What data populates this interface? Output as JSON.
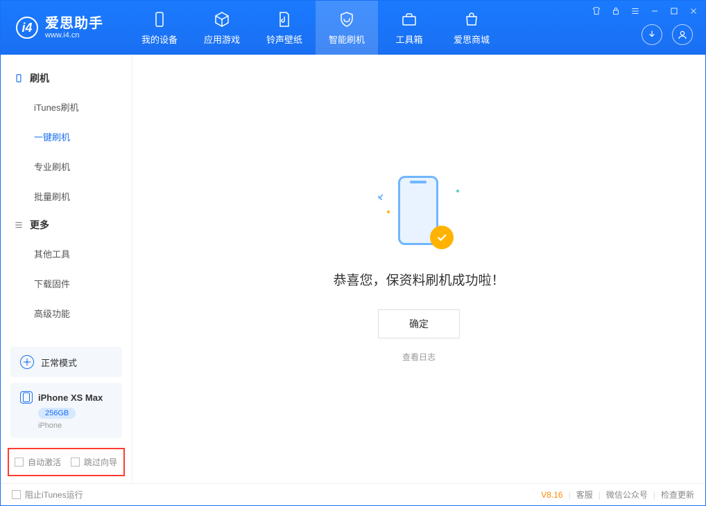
{
  "app": {
    "name": "爱思助手",
    "url": "www.i4.cn"
  },
  "nav": {
    "items": [
      {
        "label": "我的设备"
      },
      {
        "label": "应用游戏"
      },
      {
        "label": "铃声壁纸"
      },
      {
        "label": "智能刷机"
      },
      {
        "label": "工具箱"
      },
      {
        "label": "爱思商城"
      }
    ],
    "active_index": 3
  },
  "sidebar": {
    "group_flash": "刷机",
    "group_more": "更多",
    "flash_items": [
      {
        "label": "iTunes刷机"
      },
      {
        "label": "一键刷机"
      },
      {
        "label": "专业刷机"
      },
      {
        "label": "批量刷机"
      }
    ],
    "flash_active_index": 1,
    "more_items": [
      {
        "label": "其他工具"
      },
      {
        "label": "下载固件"
      },
      {
        "label": "高级功能"
      }
    ],
    "mode_label": "正常模式",
    "device": {
      "name": "iPhone XS Max",
      "capacity": "256GB",
      "type": "iPhone"
    },
    "opt_auto_activate": "自动激活",
    "opt_skip_guide": "跳过向导"
  },
  "main": {
    "success_text": "恭喜您，保资料刷机成功啦！",
    "ok_label": "确定",
    "log_link": "查看日志"
  },
  "footer": {
    "block_itunes": "阻止iTunes运行",
    "version": "V8.16",
    "link_support": "客服",
    "link_wechat": "微信公众号",
    "link_update": "检查更新"
  }
}
